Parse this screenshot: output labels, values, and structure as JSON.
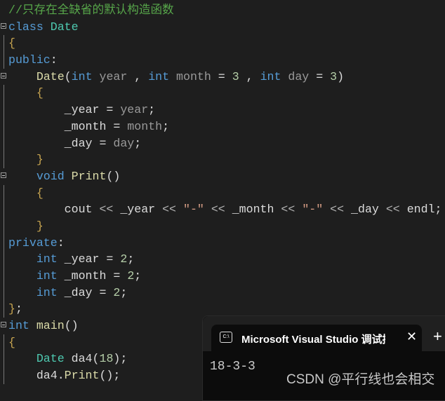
{
  "colors": {
    "background": "#1e1e1e",
    "keyword": "#569cd6",
    "type": "#4ec9b0",
    "function": "#dcdcaa",
    "parameter": "#9a9a9a",
    "number": "#b5cea8",
    "string": "#d69d85",
    "comment": "#57a64a"
  },
  "code": [
    {
      "fold": false,
      "tokens": [
        [
          "cm",
          "//只存在全缺省的默认构造函数"
        ]
      ]
    },
    {
      "fold": true,
      "tokens": [
        [
          "kw",
          "class"
        ],
        [
          "pl",
          " "
        ],
        [
          "ty",
          "Date"
        ]
      ]
    },
    {
      "tokens": [
        [
          "br",
          "{"
        ]
      ]
    },
    {
      "tokens": [
        [
          "kw",
          "public"
        ],
        [
          "pl",
          ":"
        ]
      ]
    },
    {
      "fold": true,
      "tokens": [
        [
          "pl",
          "    "
        ],
        [
          "fn",
          "Date"
        ],
        [
          "pl",
          "("
        ],
        [
          "kw",
          "int"
        ],
        [
          "pa",
          " year "
        ],
        [
          "pl",
          ", "
        ],
        [
          "kw",
          "int"
        ],
        [
          "pa",
          " month "
        ],
        [
          "pl",
          "= "
        ],
        [
          "nu",
          "3"
        ],
        [
          "pl",
          " , "
        ],
        [
          "kw",
          "int"
        ],
        [
          "pa",
          " day "
        ],
        [
          "pl",
          "= "
        ],
        [
          "nu",
          "3"
        ],
        [
          "pl",
          ")"
        ]
      ]
    },
    {
      "tokens": [
        [
          "pl",
          "    "
        ],
        [
          "br",
          "{"
        ]
      ]
    },
    {
      "tokens": [
        [
          "pl",
          "        _year = "
        ],
        [
          "pa",
          "year"
        ],
        [
          "pl",
          ";"
        ]
      ]
    },
    {
      "tokens": [
        [
          "pl",
          "        _month = "
        ],
        [
          "pa",
          "month"
        ],
        [
          "pl",
          ";"
        ]
      ]
    },
    {
      "tokens": [
        [
          "pl",
          "        _day = "
        ],
        [
          "pa",
          "day"
        ],
        [
          "pl",
          ";"
        ]
      ]
    },
    {
      "tokens": [
        [
          "pl",
          "    "
        ],
        [
          "br",
          "}"
        ]
      ]
    },
    {
      "fold": true,
      "tokens": [
        [
          "pl",
          "    "
        ],
        [
          "kw",
          "void"
        ],
        [
          "pl",
          " "
        ],
        [
          "fn",
          "Print"
        ],
        [
          "pl",
          "()"
        ]
      ]
    },
    {
      "tokens": [
        [
          "pl",
          "    "
        ],
        [
          "br",
          "{"
        ]
      ]
    },
    {
      "tokens": [
        [
          "pl",
          "        cout "
        ],
        [
          "op",
          "<<"
        ],
        [
          "pl",
          " _year "
        ],
        [
          "op",
          "<<"
        ],
        [
          "pl",
          " "
        ],
        [
          "st",
          "\"-\""
        ],
        [
          "pl",
          " "
        ],
        [
          "op",
          "<<"
        ],
        [
          "pl",
          " _month "
        ],
        [
          "op",
          "<<"
        ],
        [
          "pl",
          " "
        ],
        [
          "st",
          "\"-\""
        ],
        [
          "pl",
          " "
        ],
        [
          "op",
          "<<"
        ],
        [
          "pl",
          " _day "
        ],
        [
          "op",
          "<<"
        ],
        [
          "pl",
          " endl;"
        ]
      ]
    },
    {
      "tokens": [
        [
          "pl",
          "    "
        ],
        [
          "br",
          "}"
        ]
      ]
    },
    {
      "tokens": [
        [
          "kw",
          "private"
        ],
        [
          "pl",
          ":"
        ]
      ]
    },
    {
      "tokens": [
        [
          "pl",
          "    "
        ],
        [
          "kw",
          "int"
        ],
        [
          "pl",
          " _year = "
        ],
        [
          "nu",
          "2"
        ],
        [
          "pl",
          ";"
        ]
      ]
    },
    {
      "tokens": [
        [
          "pl",
          "    "
        ],
        [
          "kw",
          "int"
        ],
        [
          "pl",
          " _month = "
        ],
        [
          "nu",
          "2"
        ],
        [
          "pl",
          ";"
        ]
      ]
    },
    {
      "tokens": [
        [
          "pl",
          "    "
        ],
        [
          "kw",
          "int"
        ],
        [
          "pl",
          " _day = "
        ],
        [
          "nu",
          "2"
        ],
        [
          "pl",
          ";"
        ]
      ]
    },
    {
      "tokens": [
        [
          "br",
          "}"
        ],
        [
          "pl",
          ";"
        ]
      ]
    },
    {
      "fold": true,
      "tokens": [
        [
          "kw",
          "int"
        ],
        [
          "pl",
          " "
        ],
        [
          "fn",
          "main"
        ],
        [
          "pl",
          "()"
        ]
      ]
    },
    {
      "tokens": [
        [
          "br",
          "{"
        ]
      ]
    },
    {
      "tokens": [
        [
          "pl",
          "    "
        ],
        [
          "ty",
          "Date"
        ],
        [
          "pl",
          " da4("
        ],
        [
          "nu",
          "18"
        ],
        [
          "pl",
          ");"
        ]
      ]
    },
    {
      "tokens": [
        [
          "pl",
          "    da4."
        ],
        [
          "fn",
          "Print"
        ],
        [
          "pl",
          "();"
        ]
      ]
    }
  ],
  "console": {
    "icon": "terminal-icon",
    "icon_text": "C:\\",
    "tab_title": "Microsoft Visual Studio 调试控制台",
    "close": "✕",
    "new_tab": "+",
    "output": "18-3-3"
  },
  "watermark": "CSDN @平行线也会相交"
}
